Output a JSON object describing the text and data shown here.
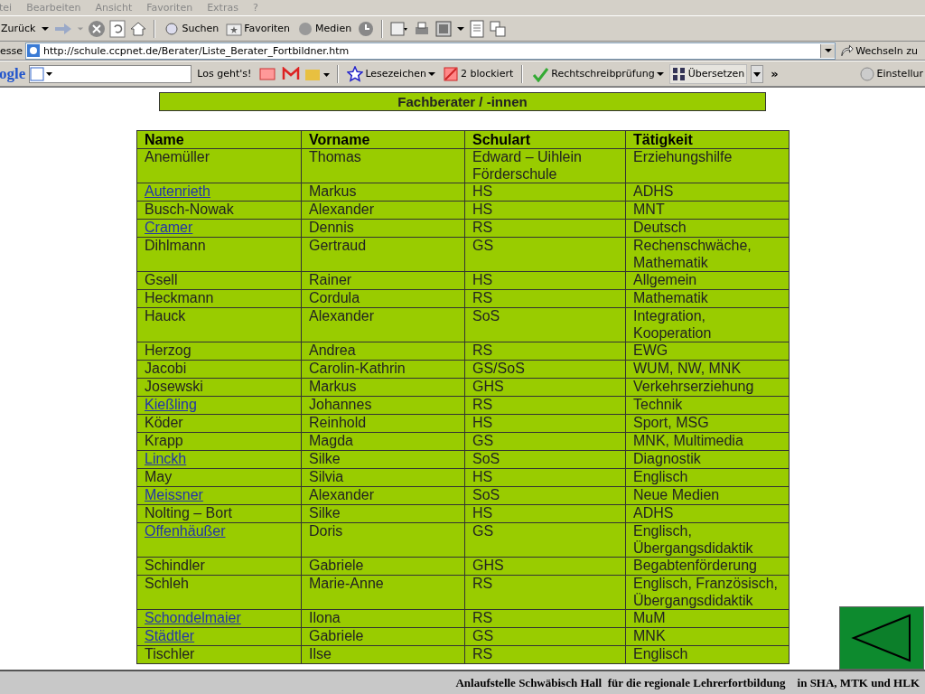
{
  "menu_bar": [
    "tei",
    "Bearbeiten",
    "Ansicht",
    "Favoriten",
    "Extras",
    "?"
  ],
  "toolbar": {
    "back": "Zurück",
    "search": "Suchen",
    "favorites": "Favoriten",
    "media": "Medien"
  },
  "address_bar": {
    "label": "esse",
    "url": "http://schule.ccpnet.de/Berater/Liste_Berater_Fortbildner.htm",
    "go": "Wechseln zu"
  },
  "google_bar": {
    "logo": "ogle",
    "search_button": "Los geht's!",
    "bookmarks": "Lesezeichen",
    "blocked": "2 blockiert",
    "spellcheck": "Rechtschreibprüfung",
    "translate": "Übersetzen",
    "more": "»",
    "settings": "Einstellur"
  },
  "page": {
    "title": "Fachberater / -innen",
    "table": {
      "columns": [
        "Name",
        "Vorname",
        "Schulart",
        "Tätigkeit"
      ],
      "rows": [
        {
          "name": "Anemüller",
          "link": false,
          "first_name": "Thomas",
          "school_type": "Edward – Uihlein Förderschule",
          "activity": "Erziehungshilfe"
        },
        {
          "name": "Autenrieth",
          "link": true,
          "first_name": "Markus",
          "school_type": "HS",
          "activity": "ADHS"
        },
        {
          "name": "Busch-Nowak",
          "link": false,
          "first_name": "Alexander",
          "school_type": "HS",
          "activity": "MNT"
        },
        {
          "name": "Cramer",
          "link": true,
          "first_name": "Dennis",
          "school_type": "RS",
          "activity": "Deutsch"
        },
        {
          "name": "Dihlmann",
          "link": false,
          "first_name": "Gertraud",
          "school_type": "GS",
          "activity": "Rechenschwäche, Mathematik"
        },
        {
          "name": "Gsell",
          "link": false,
          "first_name": "Rainer",
          "school_type": "HS",
          "activity": "Allgemein"
        },
        {
          "name": "Heckmann",
          "link": false,
          "first_name": "Cordula",
          "school_type": "RS",
          "activity": "Mathematik"
        },
        {
          "name": "Hauck",
          "link": false,
          "first_name": "Alexander",
          "school_type": "SoS",
          "activity": "Integration, Kooperation"
        },
        {
          "name": "Herzog",
          "link": false,
          "first_name": "Andrea",
          "school_type": "RS",
          "activity": "EWG"
        },
        {
          "name": "Jacobi",
          "link": false,
          "first_name": "Carolin-Kathrin",
          "school_type": "GS/SoS",
          "activity": "WUM, NW, MNK"
        },
        {
          "name": "Josewski",
          "link": false,
          "first_name": "Markus",
          "school_type": "GHS",
          "activity": "Verkehrserziehung"
        },
        {
          "name": "Kießling",
          "link": true,
          "first_name": "Johannes",
          "school_type": "RS",
          "activity": "Technik"
        },
        {
          "name": "Köder",
          "link": false,
          "first_name": "Reinhold",
          "school_type": "HS",
          "activity": "Sport, MSG"
        },
        {
          "name": "Krapp",
          "link": false,
          "first_name": "Magda",
          "school_type": "GS",
          "activity": "MNK, Multimedia"
        },
        {
          "name": "Linckh",
          "link": true,
          "first_name": "Silke",
          "school_type": "SoS",
          "activity": "Diagnostik"
        },
        {
          "name": "May",
          "link": false,
          "first_name": "Silvia",
          "school_type": "HS",
          "activity": "Englisch"
        },
        {
          "name": "Meissner",
          "link": true,
          "first_name": "Alexander",
          "school_type": "SoS",
          "activity": "Neue Medien"
        },
        {
          "name": "Nolting – Bort",
          "link": false,
          "first_name": "Silke",
          "school_type": "HS",
          "activity": "ADHS"
        },
        {
          "name": "Offenhäußer",
          "link": true,
          "first_name": "Doris",
          "school_type": "GS",
          "activity": "Englisch, Übergangsdidaktik"
        },
        {
          "name": "Schindler",
          "link": false,
          "first_name": "Gabriele",
          "school_type": "GHS",
          "activity": "Begabtenförderung"
        },
        {
          "name": "Schleh",
          "link": false,
          "first_name": "Marie-Anne",
          "school_type": "RS",
          "activity": "Englisch, Französisch, Übergangsdidaktik"
        },
        {
          "name": "Schondelmaier",
          "link": true,
          "first_name": "Ilona",
          "school_type": "RS",
          "activity": "MuM"
        },
        {
          "name": "Städtler",
          "link": true,
          "first_name": "Gabriele",
          "school_type": "GS",
          "activity": "MNK"
        },
        {
          "name": "Tischler",
          "link": false,
          "first_name": "Ilse",
          "school_type": "RS",
          "activity": "Englisch"
        }
      ]
    }
  },
  "footer": {
    "text": "Anlaufstelle Schwäbisch Hall  für die regionale Lehrerfortbildung    in SHA, MTK und HLK"
  }
}
